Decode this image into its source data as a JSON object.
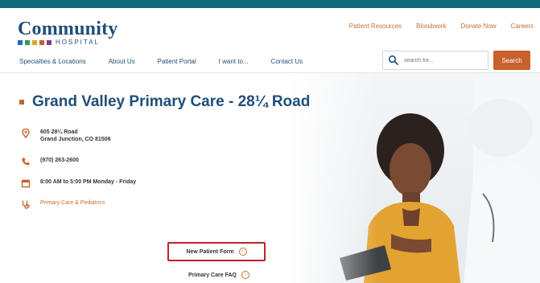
{
  "brand": {
    "name": "Community",
    "subtitle": "HOSPITAL",
    "colors": [
      "#1f6fb2",
      "#3f9a46",
      "#e0a32a",
      "#c8612b",
      "#7a3e9d"
    ]
  },
  "utility_nav": [
    "Patient Resources",
    "Bloodwork",
    "Donate Now",
    "Careers"
  ],
  "main_nav": [
    "Specialties & Locations",
    "About Us",
    "Patient Portal",
    "I want to...",
    "Contact Us"
  ],
  "search": {
    "placeholder": "search for...",
    "button": "Search"
  },
  "page": {
    "title": "Grand Valley Primary Care - 28¼ Road",
    "address_line1": "605 28¼ Road",
    "address_line2": "Grand Junction, CO 81506",
    "phone": "(970) 263-2600",
    "hours": "8:00 AM to 5:00 PM Monday - Friday",
    "service_link": "Primary Care & Pediatrics"
  },
  "actions": {
    "new_patient": "New Patient Form",
    "faq": "Primary Care FAQ"
  },
  "colors": {
    "accent": "#c8612b",
    "brand": "#1f4e79",
    "topbar": "#0b6e7a",
    "highlight": "#c0222a"
  }
}
